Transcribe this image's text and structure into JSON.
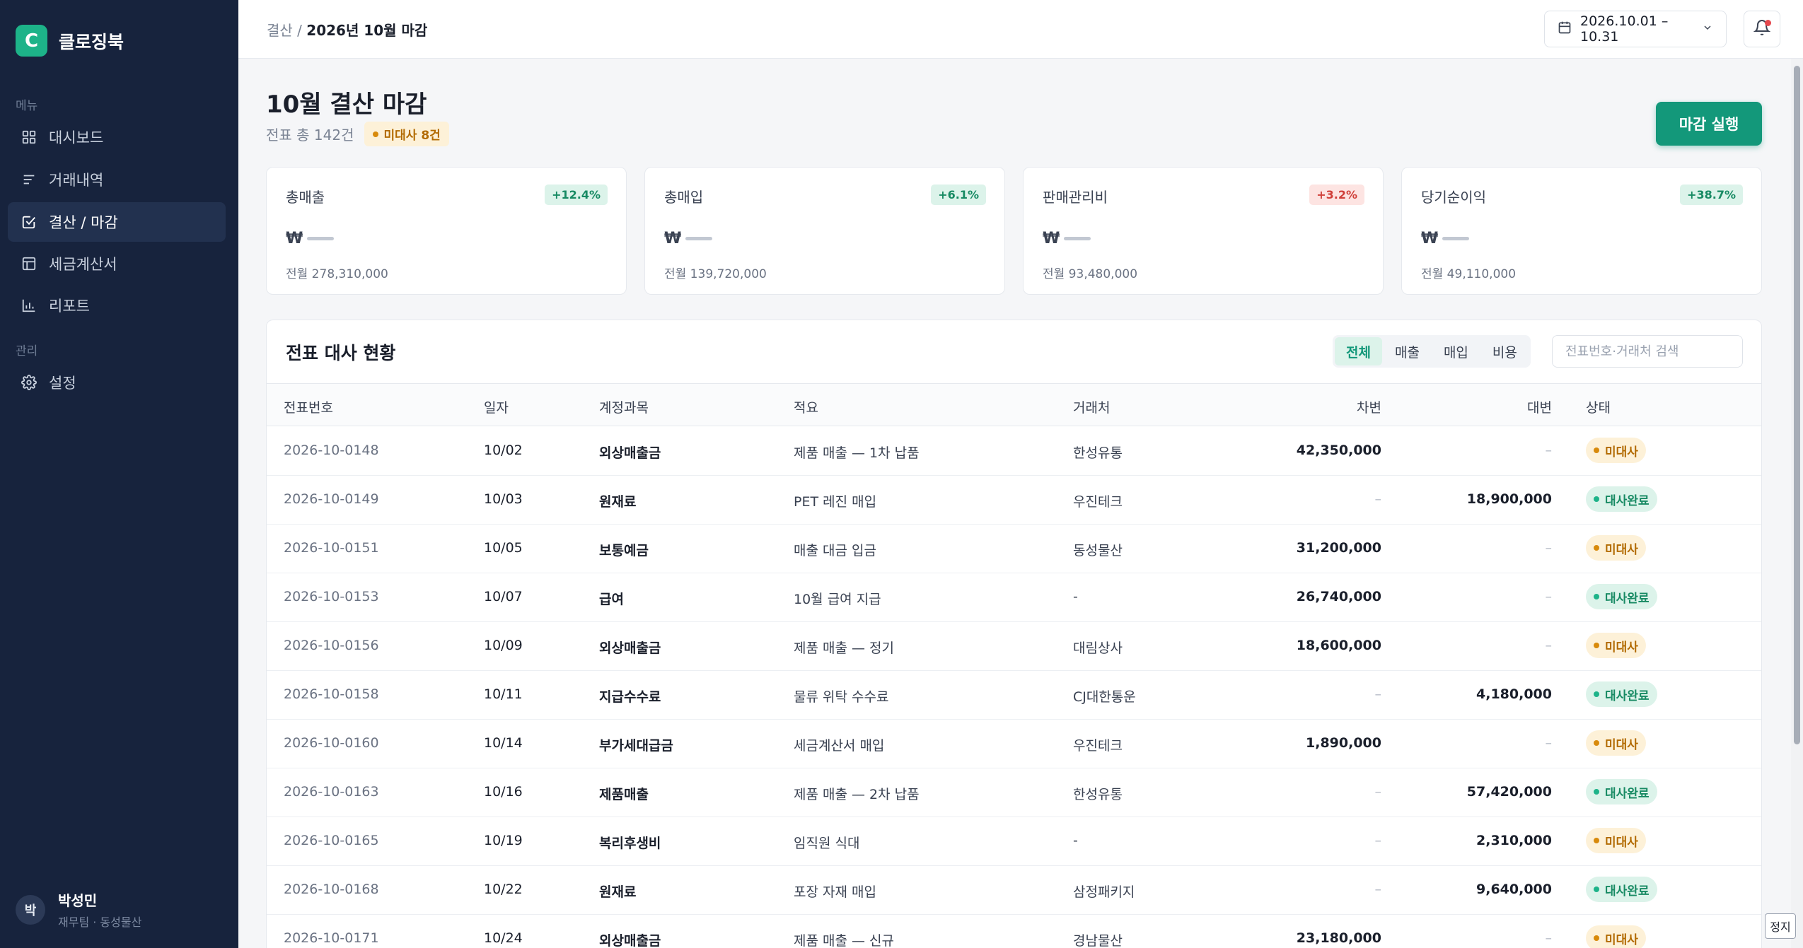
{
  "brand": {
    "logo_letter": "C",
    "name": "클로징북",
    "accent": "#1db389"
  },
  "sidebar": {
    "section_menu": "메뉴",
    "section_admin": "관리",
    "items": [
      {
        "label": "대시보드",
        "icon": "grid-icon"
      },
      {
        "label": "거래내역",
        "icon": "list-icon"
      },
      {
        "label": "결산 / 마감",
        "icon": "checkbox-icon",
        "active": true
      },
      {
        "label": "세금계산서",
        "icon": "invoice-icon"
      },
      {
        "label": "리포트",
        "icon": "bar-chart-icon"
      },
      {
        "label": "설정",
        "icon": "gear-icon"
      }
    ],
    "user": {
      "initial": "박",
      "name": "박성민",
      "role": "재무팀 · 동성물산"
    }
  },
  "topbar": {
    "breadcrumb_parent": "결산",
    "breadcrumb_sep": "/",
    "breadcrumb_current": "2026년 10월 마감",
    "date_range": "2026.10.01 – 10.31"
  },
  "page": {
    "title": "10월 결산 마감",
    "subtitle": "전표 총 142건",
    "pending_chip": "미대사 8건",
    "close_button": "마감 실행"
  },
  "kpis": [
    {
      "label": "총매출",
      "change": "+12.4%",
      "tone": "up",
      "currency": "₩",
      "prev": "전월 278,310,000"
    },
    {
      "label": "총매입",
      "change": "+6.1%",
      "tone": "up",
      "currency": "₩",
      "prev": "전월 139,720,000"
    },
    {
      "label": "판매관리비",
      "change": "+3.2%",
      "tone": "cost",
      "currency": "₩",
      "prev": "전월 93,480,000"
    },
    {
      "label": "당기순이익",
      "change": "+38.7%",
      "tone": "up",
      "currency": "₩",
      "prev": "전월 49,110,000"
    }
  ],
  "table": {
    "title": "전표 대사 현황",
    "filters": [
      "전체",
      "매출",
      "매입",
      "비용"
    ],
    "active_filter": "전체",
    "search_placeholder": "전표번호·거래처 검색",
    "columns": [
      "전표번호",
      "일자",
      "계정과목",
      "적요",
      "거래처",
      "차변",
      "대변",
      "상태"
    ],
    "rows": [
      {
        "no": "2026-10-0148",
        "date": "10/02",
        "account": "외상매출금",
        "desc": "제품 매출 — 1차 납품",
        "vendor": "한성유통",
        "debit": "42,350,000",
        "credit": "–",
        "status": "미대사",
        "state": "pending"
      },
      {
        "no": "2026-10-0149",
        "date": "10/03",
        "account": "원재료",
        "desc": "PET 레진 매입",
        "vendor": "우진테크",
        "debit": "–",
        "credit": "18,900,000",
        "status": "대사완료",
        "state": "done"
      },
      {
        "no": "2026-10-0151",
        "date": "10/05",
        "account": "보통예금",
        "desc": "매출 대금 입금",
        "vendor": "동성물산",
        "debit": "31,200,000",
        "credit": "–",
        "status": "미대사",
        "state": "pending"
      },
      {
        "no": "2026-10-0153",
        "date": "10/07",
        "account": "급여",
        "desc": "10월 급여 지급",
        "vendor": "-",
        "debit": "26,740,000",
        "credit": "–",
        "status": "대사완료",
        "state": "done"
      },
      {
        "no": "2026-10-0156",
        "date": "10/09",
        "account": "외상매출금",
        "desc": "제품 매출 — 정기",
        "vendor": "대림상사",
        "debit": "18,600,000",
        "credit": "–",
        "status": "미대사",
        "state": "pending"
      },
      {
        "no": "2026-10-0158",
        "date": "10/11",
        "account": "지급수수료",
        "desc": "물류 위탁 수수료",
        "vendor": "CJ대한통운",
        "debit": "–",
        "credit": "4,180,000",
        "status": "대사완료",
        "state": "done"
      },
      {
        "no": "2026-10-0160",
        "date": "10/14",
        "account": "부가세대급금",
        "desc": "세금계산서 매입",
        "vendor": "우진테크",
        "debit": "1,890,000",
        "credit": "–",
        "status": "미대사",
        "state": "pending"
      },
      {
        "no": "2026-10-0163",
        "date": "10/16",
        "account": "제품매출",
        "desc": "제품 매출 — 2차 납품",
        "vendor": "한성유통",
        "debit": "–",
        "credit": "57,420,000",
        "status": "대사완료",
        "state": "done"
      },
      {
        "no": "2026-10-0165",
        "date": "10/19",
        "account": "복리후생비",
        "desc": "임직원 식대",
        "vendor": "-",
        "debit": "–",
        "credit": "2,310,000",
        "status": "미대사",
        "state": "pending"
      },
      {
        "no": "2026-10-0168",
        "date": "10/22",
        "account": "원재료",
        "desc": "포장 자재 매입",
        "vendor": "삼정패키지",
        "debit": "–",
        "credit": "9,640,000",
        "status": "대사완료",
        "state": "done"
      },
      {
        "no": "2026-10-0171",
        "date": "10/24",
        "account": "외상매출금",
        "desc": "제품 매출 — 신규",
        "vendor": "경남물산",
        "debit": "23,180,000",
        "credit": "–",
        "status": "미대사",
        "state": "pending"
      }
    ]
  },
  "tooltip": {
    "stop": "정지"
  }
}
